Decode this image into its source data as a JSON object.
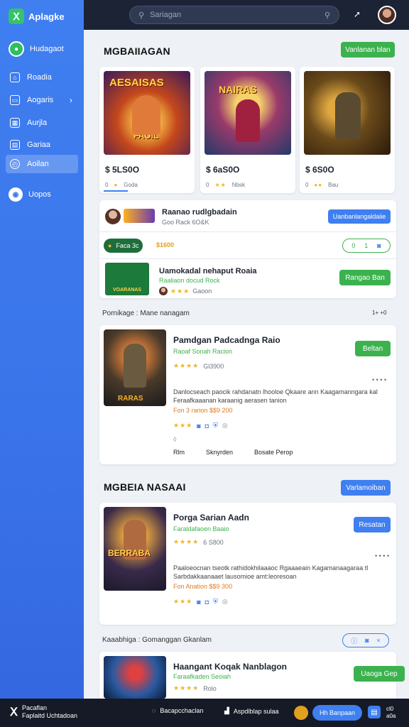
{
  "colors": {
    "accent": "#3f7ff0",
    "green": "#3cb24f",
    "sidebar": "#3a74ea",
    "topbar": "#1b2334"
  },
  "sidebar": {
    "brand": "Aplagke",
    "top_item": "Hudagaot",
    "items": [
      {
        "label": "Roadia",
        "icon": "home-icon"
      },
      {
        "label": "Aogaris",
        "icon": "monitor-icon",
        "chevron": "›"
      },
      {
        "label": "Aurjla",
        "icon": "grid-icon"
      },
      {
        "label": "Gariaa",
        "icon": "calendar-icon"
      },
      {
        "label": "Aoilan",
        "icon": "clock-icon",
        "active": true
      }
    ],
    "bottom_item": "Uopos"
  },
  "topbar": {
    "search_placeholder": "Sariagan"
  },
  "featured": {
    "title": "MGBAIIAGAN",
    "button": "Vanlanan blan",
    "cards": [
      {
        "art_text": "AESAISAS",
        "art_sub": "FAOIL",
        "price": "$ 5LS0O",
        "meta_a": "0",
        "meta_b": "Goda"
      },
      {
        "art_text": "NAIRAS",
        "art_sub": "",
        "price": "$ 6aS0O",
        "meta_a": "0",
        "meta_b": "Nbsk"
      },
      {
        "art_text": "",
        "art_sub": "",
        "price": "$ 6S0O",
        "meta_a": "0",
        "meta_b": "Bau"
      }
    ]
  },
  "promo": {
    "row1": {
      "title": "Raanao rudlgbadain",
      "sub": "Goo Rack 6O&K",
      "button": "Uanbanlangaldaiie"
    },
    "row2": {
      "pill": "Faca 3c",
      "price": "$1600",
      "chip_a": "0",
      "chip_b": "1"
    },
    "row3": {
      "logo_text": "VOARANAS",
      "title": "Uamokadal nehaput Roaia",
      "sub": "Raaliaon docud Rock",
      "rating": "Gaoon",
      "button": "Rangao Ban"
    }
  },
  "section2_label": "Pornikage : Mane nanagam",
  "section2_right": "1+ +0",
  "feature1": {
    "art_text": "RARAS",
    "title": "Pamdgan Padcadnga Raio",
    "sub": "Raoaf Sonah Racion",
    "rating": "Gl3900",
    "button": "Beltan",
    "desc1": "Danlocseach paocik rahdanatn lhooloe Qkaare ann Kaagamanngara kal",
    "desc2": "Feraafkaaanan karaanig aerasen tanion",
    "price_line": "Fon 3 rarion  $$9 200",
    "links": [
      "Rlm",
      "Sknyrden",
      "Bosate Perop"
    ]
  },
  "section3": {
    "title": "MGBEIA NASAAI",
    "button": "Varlamoiban"
  },
  "feature2": {
    "art_text": "BERRABA",
    "title": "Porga Sarian Aadn",
    "sub": "Faraldafaoen Baaio",
    "rating": "6 S800",
    "button": "Resatan",
    "desc1": "Paaloeocnan tseotk rathidokhilaaaoc Rgaaaeain Kagamanaagaraa tl",
    "desc2": "Sarbdakkaanaaet lausomioe amt:leoresoan",
    "price_line": "Fon Anation  $$9 300"
  },
  "section4_label": "Kaaabhiga : Gomanggan Gkanlam",
  "feature3": {
    "title": "Haangant Koqak Nanblagon",
    "sub": "Faraafkaden Seoiah",
    "rating": "Rolo",
    "button": "Uaoga Gep"
  },
  "bottombar": {
    "brand1": "Pacaflan",
    "brand2": "Faplaitd Uchtadoan",
    "item1": "Bacapcchaclan",
    "item2": "Aspdlblap sulaa",
    "pill": "Hh Banpaan",
    "right1": "cl0",
    "right2": "a0a"
  }
}
